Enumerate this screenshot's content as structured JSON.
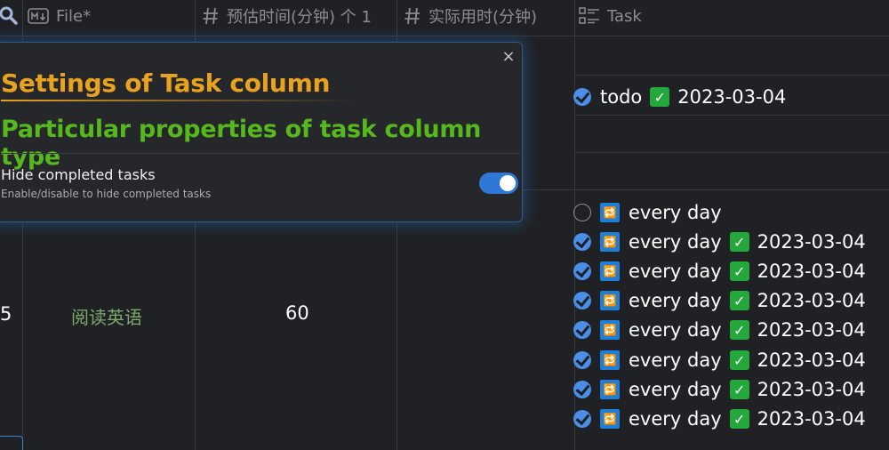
{
  "header": {
    "file_col": "File*",
    "estimate_col": "预估时间(分钟) 个 1",
    "actual_col": "实际用时(分钟)",
    "task_col": "Task"
  },
  "row": {
    "index": "5",
    "file_name": "阅读英语",
    "estimate": "60"
  },
  "tasks": {
    "todo": {
      "label": "todo",
      "date": "2023-03-04"
    },
    "items": [
      {
        "text": "every day",
        "done": false,
        "date": ""
      },
      {
        "text": "every day",
        "done": true,
        "date": "2023-03-04"
      },
      {
        "text": "every day",
        "done": true,
        "date": "2023-03-04"
      },
      {
        "text": "every day",
        "done": true,
        "date": "2023-03-04"
      },
      {
        "text": "every day",
        "done": true,
        "date": "2023-03-04"
      },
      {
        "text": "every day",
        "done": true,
        "date": "2023-03-04"
      },
      {
        "text": "every day",
        "done": true,
        "date": "2023-03-04"
      },
      {
        "text": "every day",
        "done": true,
        "date": "2023-03-04"
      }
    ]
  },
  "popup": {
    "title": "Settings of Task column",
    "subtitle": "Particular properties of task column type",
    "close_symbol": "×",
    "setting_label": "Hide completed tasks",
    "setting_description": "Enable/disable to hide completed tasks",
    "setting_enabled": true
  },
  "colors": {
    "background": "#202124",
    "title": "#e8a21f",
    "subtitle": "#56b81d",
    "accent": "#2f78d6",
    "file_link": "#7ea86a"
  }
}
